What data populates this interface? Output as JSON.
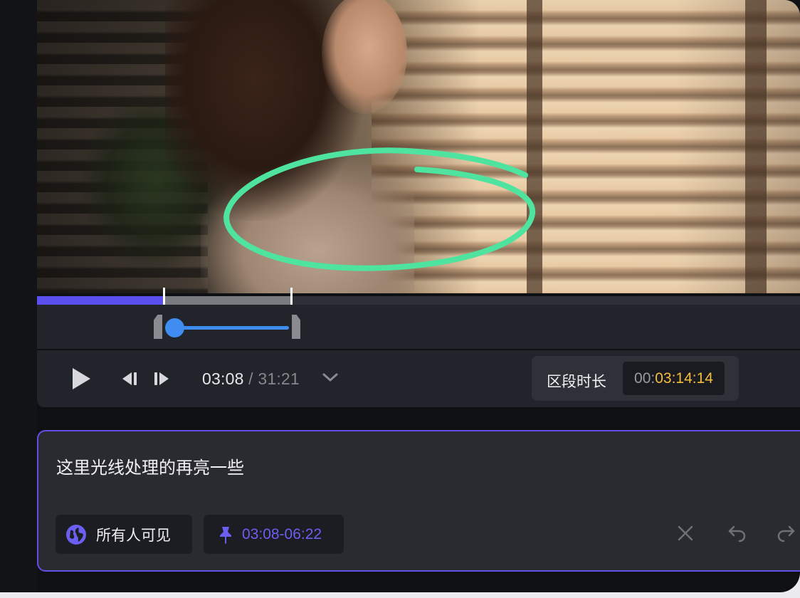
{
  "player": {
    "current_time": "03:08",
    "separator": " / ",
    "total_time": "31:21",
    "played_fraction": 0.165,
    "range_start_fraction": 0.165,
    "range_end_fraction": 0.335
  },
  "segment": {
    "label": "区段时长",
    "value_prefix": "00:",
    "value_main": "03:14:14"
  },
  "comment": {
    "text": "这里光线处理的再亮一些",
    "visibility_label": "所有人可见",
    "time_range": "03:08-06:22"
  },
  "icons": {
    "play": "play-icon",
    "prev_frame": "step-back-icon",
    "next_frame": "step-forward-icon",
    "dropdown": "chevron-down-icon",
    "visibility": "globe-icon",
    "pin": "pin-icon",
    "close": "close-icon",
    "undo": "undo-icon",
    "redo": "redo-icon"
  },
  "colors": {
    "accent_purple": "#5e50e8",
    "annotation_green": "#4fe3a0",
    "range_blue": "#3f8df0",
    "duration_yellow": "#f5bd3c"
  }
}
